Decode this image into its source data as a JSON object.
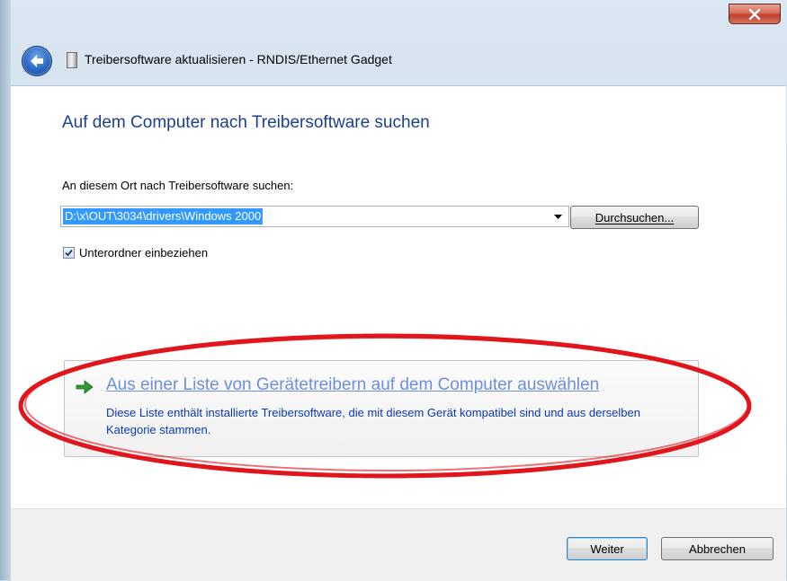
{
  "window": {
    "title": "Treibersoftware aktualisieren - RNDIS/Ethernet Gadget",
    "close_symbol": "x"
  },
  "icons": {
    "back": "back-arrow-icon",
    "device": "device-icon",
    "close": "close-icon",
    "dropdown": "chevron-down-icon",
    "checkmark": "checkmark-icon",
    "option": "green-arrow-icon"
  },
  "main": {
    "heading": "Auf dem Computer nach Treibersoftware suchen",
    "path_label": "An diesem Ort nach Treibersoftware suchen:",
    "path_value": "D:\\x\\OUT\\3034\\drivers\\Windows 2000",
    "browse_button": "Durchsuchen...",
    "subfolder_checkbox": {
      "label": "Unterordner einbeziehen",
      "checked": true
    }
  },
  "option": {
    "title": "Aus einer Liste von Gerätetreibern auf dem Computer auswählen",
    "description": "Diese Liste enthält installierte Treibersoftware, die mit diesem Gerät kompatibel sind und aus derselben Kategorie stammen."
  },
  "footer": {
    "next_button": "Weiter",
    "cancel_button": "Abbrechen"
  },
  "colors": {
    "heading": "#1e3f8f",
    "link": "#6f8fd8",
    "description": "#0a38b5",
    "selection": "#3399ff",
    "annotation_ellipse": "#e0161c"
  }
}
